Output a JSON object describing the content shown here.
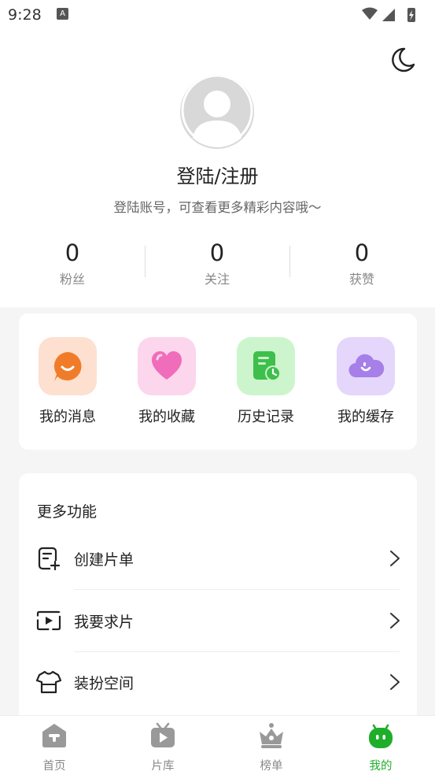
{
  "status_bar": {
    "time": "9:28",
    "notification_icon_letter": "A"
  },
  "profile": {
    "title": "登陆/注册",
    "subtitle": "登陆账号，可查看更多精彩内容哦～"
  },
  "stats": [
    {
      "value": "0",
      "label": "粉丝"
    },
    {
      "value": "0",
      "label": "关注"
    },
    {
      "value": "0",
      "label": "获赞"
    }
  ],
  "quick_actions": [
    {
      "label": "我的消息",
      "icon": "message-bubble-icon"
    },
    {
      "label": "我的收藏",
      "icon": "heart-icon"
    },
    {
      "label": "历史记录",
      "icon": "history-document-icon"
    },
    {
      "label": "我的缓存",
      "icon": "cloud-icon"
    }
  ],
  "more": {
    "title": "更多功能",
    "items": [
      {
        "label": "创建片单",
        "icon": "create-list-icon"
      },
      {
        "label": "我要求片",
        "icon": "request-video-icon"
      },
      {
        "label": "装扮空间",
        "icon": "tshirt-icon"
      }
    ]
  },
  "tabbar": {
    "items": [
      {
        "label": "首页",
        "icon": "home-icon"
      },
      {
        "label": "片库",
        "icon": "tv-play-icon"
      },
      {
        "label": "榜单",
        "icon": "crown-icon"
      },
      {
        "label": "我的",
        "icon": "mascot-icon"
      }
    ],
    "active_index": 3
  },
  "colors": {
    "accent": "#1fae29",
    "background": "#f5f5f6",
    "message_icon": "#f07c2a",
    "heart_icon": "#f06dbb",
    "history_icon": "#3ebf4c",
    "cache_icon": "#a67fe8"
  }
}
